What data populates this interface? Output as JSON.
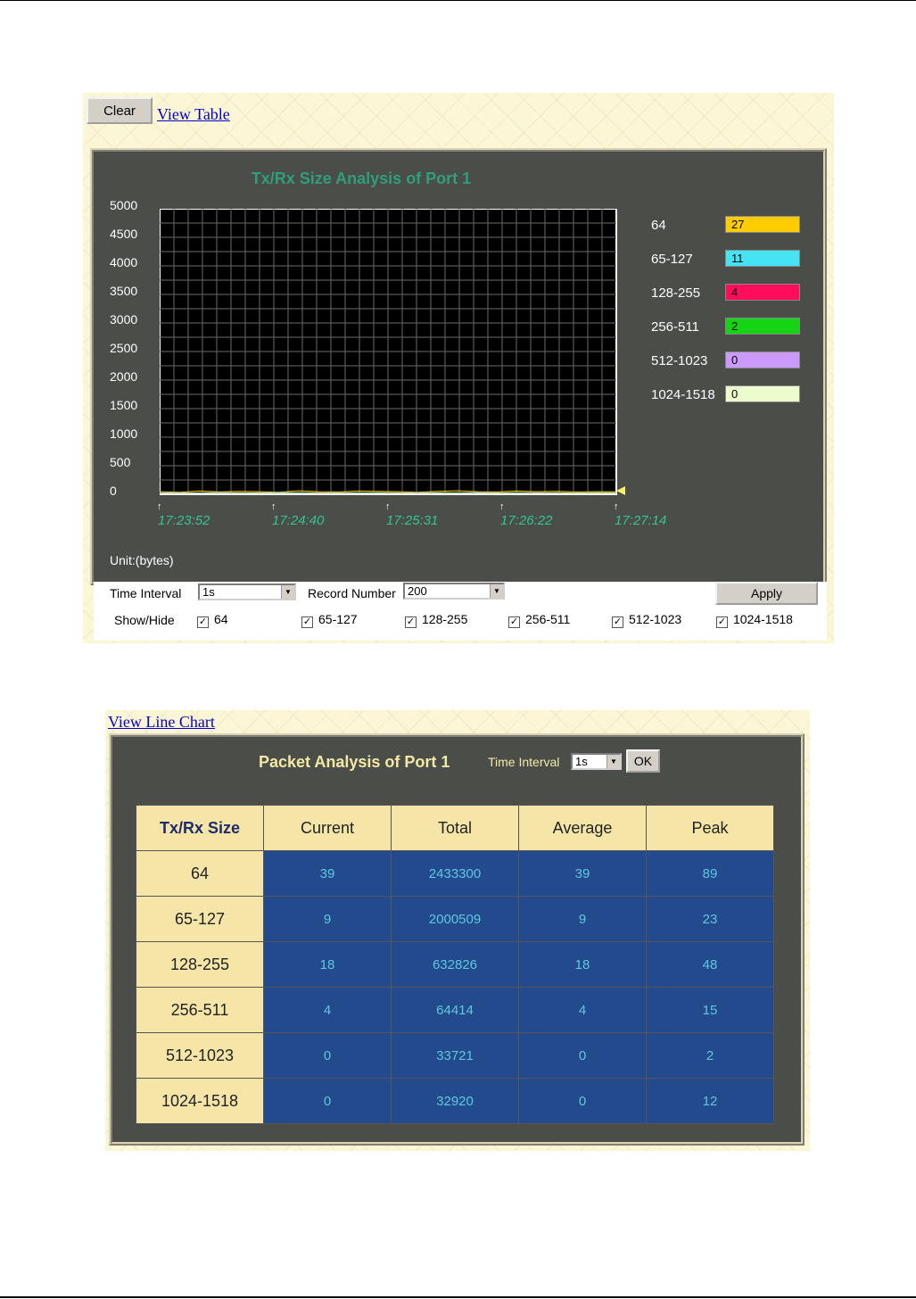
{
  "line_chart_panel": {
    "clear_label": "Clear",
    "view_table_label": "View Table",
    "title": "Tx/Rx Size Analysis of Port 1",
    "unit_label": "Unit:(bytes)",
    "legend": [
      {
        "label": "64",
        "value": "27",
        "color": "#ffcc00"
      },
      {
        "label": "65-127",
        "value": "11",
        "color": "#44e4f4"
      },
      {
        "label": "128-255",
        "value": "4",
        "color": "#ff0c5c"
      },
      {
        "label": "256-511",
        "value": "2",
        "color": "#14d414"
      },
      {
        "label": "512-1023",
        "value": "0",
        "color": "#cc99ff"
      },
      {
        "label": "1024-1518",
        "value": "0",
        "color": "#ecfccc"
      }
    ],
    "controls": {
      "time_interval_label": "Time Interval",
      "time_interval_value": "1s",
      "record_number_label": "Record Number",
      "record_number_value": "200",
      "apply_label": "Apply",
      "show_hide_label": "Show/Hide",
      "checkboxes": [
        {
          "label": "64",
          "checked": true
        },
        {
          "label": "65-127",
          "checked": true
        },
        {
          "label": "128-255",
          "checked": true
        },
        {
          "label": "256-511",
          "checked": true
        },
        {
          "label": "512-1023",
          "checked": true
        },
        {
          "label": "1024-1518",
          "checked": true
        }
      ]
    }
  },
  "chart_data": {
    "type": "line",
    "title": "Tx/Rx Size Analysis of Port 1",
    "ylabel": "Unit:(bytes)",
    "ylim": [
      0,
      5000
    ],
    "y_ticks": [
      "5000",
      "4500",
      "4000",
      "3500",
      "3000",
      "2500",
      "2000",
      "1500",
      "1000",
      "500",
      "0"
    ],
    "x_ticks": [
      "17:23:52",
      "17:24:40",
      "17:25:31",
      "17:26:22",
      "17:27:14"
    ],
    "grid": true,
    "legend_position": "right",
    "series": [
      {
        "name": "64",
        "color": "#ffcc00",
        "values": [
          30,
          20,
          40,
          25,
          35,
          30,
          20,
          45,
          30,
          25,
          40,
          35,
          30,
          20,
          35,
          45,
          30,
          25,
          40,
          30,
          35,
          25,
          30,
          27
        ]
      },
      {
        "name": "65-127",
        "color": "#44e4f4",
        "values": [
          10,
          12,
          8,
          15,
          10,
          9,
          14,
          11,
          10,
          12,
          9,
          13,
          10,
          11,
          12,
          9,
          14,
          10,
          11,
          12,
          10,
          9,
          11,
          11
        ]
      },
      {
        "name": "128-255",
        "color": "#ff0c5c",
        "values": [
          4,
          5,
          3,
          6,
          4,
          5,
          3,
          4,
          6,
          4,
          5,
          3,
          4,
          6,
          5,
          4,
          3,
          5,
          4,
          6,
          4,
          3,
          5,
          4
        ]
      },
      {
        "name": "256-511",
        "color": "#14d414",
        "values": [
          2,
          3,
          2,
          1,
          3,
          2,
          2,
          3,
          1,
          2,
          3,
          2,
          2,
          1,
          3,
          2,
          2,
          3,
          2,
          1,
          2,
          3,
          2,
          2
        ]
      },
      {
        "name": "512-1023",
        "color": "#cc99ff",
        "values": [
          0,
          1,
          0,
          0,
          1,
          0,
          0,
          1,
          0,
          0,
          1,
          0,
          0,
          1,
          0,
          0,
          1,
          0,
          0,
          1,
          0,
          0,
          0,
          0
        ]
      },
      {
        "name": "1024-1518",
        "color": "#ecfccc",
        "values": [
          0,
          0,
          1,
          0,
          0,
          1,
          0,
          0,
          1,
          0,
          0,
          1,
          0,
          0,
          1,
          0,
          0,
          1,
          0,
          0,
          1,
          0,
          0,
          0
        ]
      }
    ]
  },
  "table_panel": {
    "view_line_chart_label": "View Line Chart",
    "title": "Packet Analysis of Port 1",
    "time_interval_label": "Time Interval",
    "time_interval_value": "1s",
    "ok_label": "OK",
    "headers": [
      "Tx/Rx Size",
      "Current",
      "Total",
      "Average",
      "Peak"
    ],
    "rows": [
      [
        "64",
        "39",
        "2433300",
        "39",
        "89"
      ],
      [
        "65-127",
        "9",
        "2000509",
        "9",
        "23"
      ],
      [
        "128-255",
        "18",
        "632826",
        "18",
        "48"
      ],
      [
        "256-511",
        "4",
        "64414",
        "4",
        "15"
      ],
      [
        "512-1023",
        "0",
        "33721",
        "0",
        "2"
      ],
      [
        "1024-1518",
        "0",
        "32920",
        "0",
        "12"
      ]
    ]
  }
}
